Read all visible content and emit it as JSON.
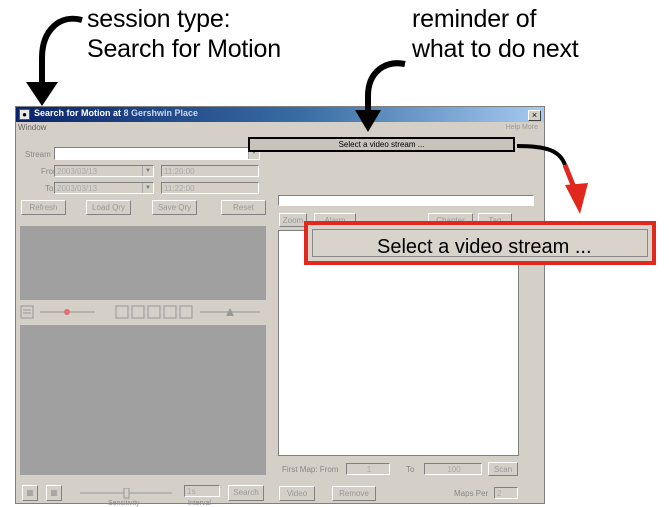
{
  "annotations": {
    "session_type_line1": "session type:",
    "session_type_line2": "Search for Motion",
    "reminder_line1": "reminder of",
    "reminder_line2": "what to do next",
    "zoom_text": "Select a video stream ..."
  },
  "window": {
    "title": "Search for Motion at",
    "title_location": "8 Gershwin Place",
    "menu": "Window",
    "close_glyph": "×",
    "help_hint": "Help  More"
  },
  "left_panel": {
    "stream_label": "Stream",
    "from_label": "From",
    "to_label": "To",
    "from_date": "2003/03/13",
    "from_time": "11:20:00",
    "to_date": "2003/03/13",
    "to_time": "11:22:00",
    "buttons": [
      "Refresh",
      "Load Qry",
      "Save Qry",
      "Reset"
    ],
    "sensitivity_label": "Sensitivity",
    "interval_label": "Interval",
    "interval_value": "1s",
    "search_button": "Search"
  },
  "right_panel": {
    "status_text": "Select a video stream ...",
    "buttons_top": [
      "Zoom",
      "Alarm",
      "Chapter",
      "Tag"
    ],
    "first_map_from_label": "First Map: From",
    "from_value": "1",
    "to_label": "To",
    "to_value": "100",
    "go_button": "Scan",
    "video_button": "Video",
    "remove_button": "Remove",
    "max_per_label": "Maps Per",
    "max_per_value": "2"
  },
  "colors": {
    "callout_arrow_red": "#e0281e",
    "title_bar": "#0a246a"
  }
}
